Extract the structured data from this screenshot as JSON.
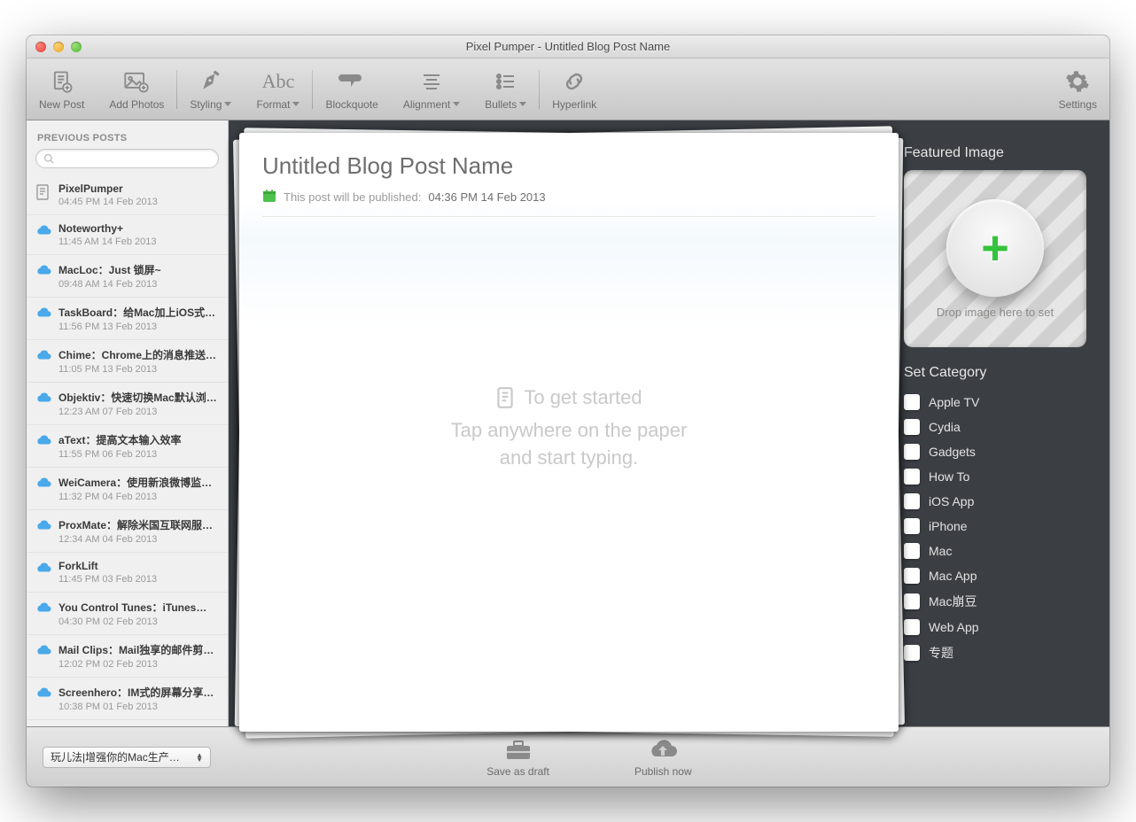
{
  "window_title": "Pixel Pumper - Untitled Blog Post Name",
  "toolbar": {
    "new_post": "New Post",
    "add_photos": "Add Photos",
    "styling": "Styling",
    "format": "Format",
    "blockquote": "Blockquote",
    "alignment": "Alignment",
    "bullets": "Bullets",
    "hyperlink": "Hyperlink",
    "settings": "Settings"
  },
  "sidebar": {
    "heading": "PREVIOUS POSTS",
    "search_placeholder": "",
    "posts": [
      {
        "icon": "doc",
        "title": "PixelPumper",
        "date": "04:45 PM 14 Feb 2013"
      },
      {
        "icon": "cloud",
        "title": "Noteworthy+",
        "date": "11:45 AM 14 Feb 2013"
      },
      {
        "icon": "cloud",
        "title": "MacLoc：Just 锁屏~",
        "date": "09:48 AM 14 Feb 2013"
      },
      {
        "icon": "cloud",
        "title": "TaskBoard：给Mac加上iOS式…",
        "date": "11:56 PM 13 Feb 2013"
      },
      {
        "icon": "cloud",
        "title": "Chime：Chrome上的消息推送…",
        "date": "11:05 PM 13 Feb 2013"
      },
      {
        "icon": "cloud",
        "title": "Objektiv：快速切换Mac默认浏…",
        "date": "12:23 AM 07 Feb 2013"
      },
      {
        "icon": "cloud",
        "title": "aText：提高文本输入效率",
        "date": "11:55 PM 06 Feb 2013"
      },
      {
        "icon": "cloud",
        "title": "WeiCamera：使用新浪微博监…",
        "date": "11:32 PM 04 Feb 2013"
      },
      {
        "icon": "cloud",
        "title": "ProxMate：解除米国互联网服…",
        "date": "12:34 AM 04 Feb 2013"
      },
      {
        "icon": "cloud",
        "title": "ForkLift",
        "date": "11:45 PM 03 Feb 2013"
      },
      {
        "icon": "cloud",
        "title": "You Control Tunes：iTunes…",
        "date": "04:30 PM 02 Feb 2013"
      },
      {
        "icon": "cloud",
        "title": "Mail Clips：Mail独享的邮件剪…",
        "date": "12:02 PM 02 Feb 2013"
      },
      {
        "icon": "cloud",
        "title": "Screenhero：IM式的屏幕分享…",
        "date": "10:38 PM 01 Feb 2013"
      }
    ]
  },
  "editor": {
    "title": "Untitled Blog Post Name",
    "publish_label": "This post will be published:",
    "publish_time": "04:36 PM 14 Feb 2013",
    "placeholder_line1": "To get started",
    "placeholder_line2": "Tap anywhere on the paper",
    "placeholder_line3": "and start typing."
  },
  "right": {
    "featured_heading": "Featured Image",
    "drop_caption": "Drop image here to set",
    "category_heading": "Set Category",
    "categories": [
      "Apple TV",
      "Cydia",
      "Gadgets",
      "How To",
      "iOS App",
      "iPhone",
      "Mac",
      "Mac App",
      "Mac崩豆",
      "Web App",
      "专题"
    ]
  },
  "footer": {
    "blog_select": "玩儿法|增强你的Mac生产…",
    "save_draft": "Save as draft",
    "publish": "Publish now"
  }
}
